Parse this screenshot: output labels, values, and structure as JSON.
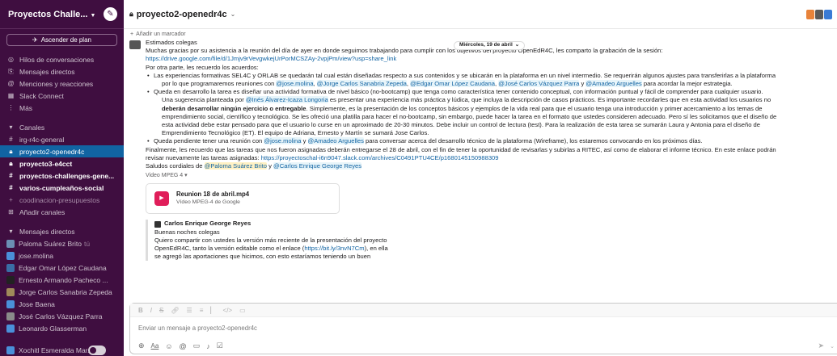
{
  "workspace": {
    "name": "Proyectos Challe...",
    "upgrade_label": "Ascender de plan"
  },
  "nav": [
    {
      "label": "Hilos de conversaciones"
    },
    {
      "label": "Mensajes directos"
    },
    {
      "label": "Menciones y reacciones"
    },
    {
      "label": "Slack Connect"
    },
    {
      "label": "Más"
    }
  ],
  "channels_header": "Canales",
  "channels": [
    {
      "name": "irg-r4c-general"
    },
    {
      "name": "proyecto2-openedr4c"
    },
    {
      "name": "proyecto3-e4cct"
    },
    {
      "name": "proyectos-challenges-gene..."
    },
    {
      "name": "varios-cumpleaños-social"
    },
    {
      "name": "coodinacion-presupuestos"
    },
    {
      "name": "Añadir canales"
    }
  ],
  "dms_header": "Mensajes directos",
  "dms": [
    {
      "name": "Paloma Suárez Brito",
      "note": "tú",
      "color": "#6b8fb3"
    },
    {
      "name": "jose.molina",
      "color": "#4a90d9"
    },
    {
      "name": "Edgar Omar López Caudana",
      "color": "#3a6ea5"
    },
    {
      "name": "Ernesto Armando Pacheco ...",
      "color": "#222222"
    },
    {
      "name": "Jorge Carlos Sanabria Zepeda",
      "color": "#a08a5a"
    },
    {
      "name": "Jose Baena",
      "color": "#4a90d9"
    },
    {
      "name": "José Carlos Vázquez Parra",
      "color": "#8a8a8a"
    },
    {
      "name": "Leonardo Glasserman",
      "color": "#4a90d9"
    },
    {
      "name": "Xochitl Esmeralda Mar...",
      "color": "#4a90d9"
    }
  ],
  "channel": {
    "title": "proyecto2-openedr4c",
    "bookmark_label": "Añadir un marcador",
    "member_colors": [
      "#e8833a",
      "#5a5a5a",
      "#3a7bd5"
    ]
  },
  "date_pill": "Miércoles, 19 de abril",
  "message": {
    "greeting": "Estimados colegas",
    "line1": "Muchas gracias por su asistencia a la reunión del día de ayer en donde seguimos trabajando para cumplir con los objetivos del proyecto OpenEdR4C, les comparto la grabación de la sesión:",
    "link1": "https://drive.google.com/file/d/1Jmjv9rVevgwkejUrPorMCSZAy-2vpjPm/view?usp=share_link",
    "line2": "Por otra parte, les recuerdo los acuerdos:",
    "b1_l1": "Las experiencias formativas SEL4C y ORLAB se quedarán tal cual están diseñadas respecto a sus contenidos y se ubicarán en la plataforma en un nivel intermedio. Se requerirán algunos ajustes para transferirlas a la plataforma",
    "b1_l2_pre": "por lo que programaremos reuniones con ",
    "b1_m1": "@jose.molina",
    "b1_m2": "@Jorge Carlos Sanabria Zepeda",
    "b1_m3": "@Edgar Omar López Caudana",
    "b1_m4": "@José Carlos Vázquez Parra",
    "b1_y": " y ",
    "b1_m5": "@Amadeo Arguelles",
    "b1_end": " para acordar la mejor estrategia.",
    "b2_l1": "Queda en desarrollo la tarea es diseñar una actividad formativa de nivel básico (no-bootcamp) que tenga como característica tener contenido conceptual, con información puntual y fácil de comprender para cualquier usuario.",
    "b2_l2_pre": "Una sugerencia planteada por ",
    "b2_m1": "@Inés Álvarez-Icaza Longoria",
    "b2_l2_post": " es presentar una experiencia más práctica y lúdica, que incluya la descripción de casos prácticos. Es importante recordarles que en esta actividad los usuarios no",
    "b2_l3_bold": "deberán desarrollar ningún ejercicio o entregable",
    "b2_l3_post": ". Simplemente, es la presentación de los conceptos básicos y ejemplos de la vida real para que el usuario tenga una introducción y primer acercamiento a los temas de",
    "b2_l4": "emprendimiento social, científico y tecnológico. Se les ofreció una platilla para hacer el no-bootcamp, sin embargo, puede hacer la tarea en el formato que ustedes consideren adecuado. Pero sí les solicitamos que el diseño de",
    "b2_l5": "esta actividad debe estar pensado para que el usuario lo curse en un aproximado de 20-30 minutos. Debe incluir un control de lectura (test). Para la realización de esta tarea se sumarán Laura y Antonia para el diseño de",
    "b2_l6": "Emprendimiento Tecnológico (ET). El equipo de Adriana, Ernesto y Martín se sumará Jose Carlos.",
    "b3_pre": "Queda pendiente tener una reunión con ",
    "b3_m1": "@jose.molina",
    "b3_y": " y ",
    "b3_m2": "@Amadeo Arguelles",
    "b3_post": " para conversar acerca del desarrollo técnico de la plataforma (Wireframe), los estaremos convocando en los próximos días.",
    "final_l1": "Finalmente, les recuerdo que las tareas que nos fueron asignadas deberán entregarse el 28 de abril, con el fin de tener la oportunidad de revisarlas y subirlas a RITEC, así como de elaborar el informe técnico. En este enlace podrán",
    "final_l2_pre": "revisar nuevamente las tareas asignadas: ",
    "link2": "https://proyectoschal-i6n9047.slack.com/archives/C0491PTU4CE/p1680145150988309",
    "regards_pre": "Saludos cordiales de ",
    "regards_m1": "@Paloma Suárez Brito",
    "regards_y": " y ",
    "regards_m2": "@Carlos Enrique George Reyes"
  },
  "attachment": {
    "label": "Video MPEG 4",
    "file_name": "Reunion 18 de abril.mp4",
    "file_sub": "Vídeo MPEG-4 de Google"
  },
  "quote": {
    "author": "Carlos Enrique George Reyes",
    "l1": "Buenas noches colegas",
    "l2": "Quiero compartir con ustedes la versión más reciente de la presentación del proyecto",
    "l3_pre": "OpenEdR4C, tanto la versión editable como el enlace (",
    "l3_link": "https://bit.ly/3nvN7Cm",
    "l3_post": "), en ella",
    "l4": "se agregó las aportaciones que hicimos, con esto estaríamos teniendo un buen"
  },
  "composer": {
    "placeholder": "Enviar un mensaje a proyecto2-openedr4c"
  }
}
